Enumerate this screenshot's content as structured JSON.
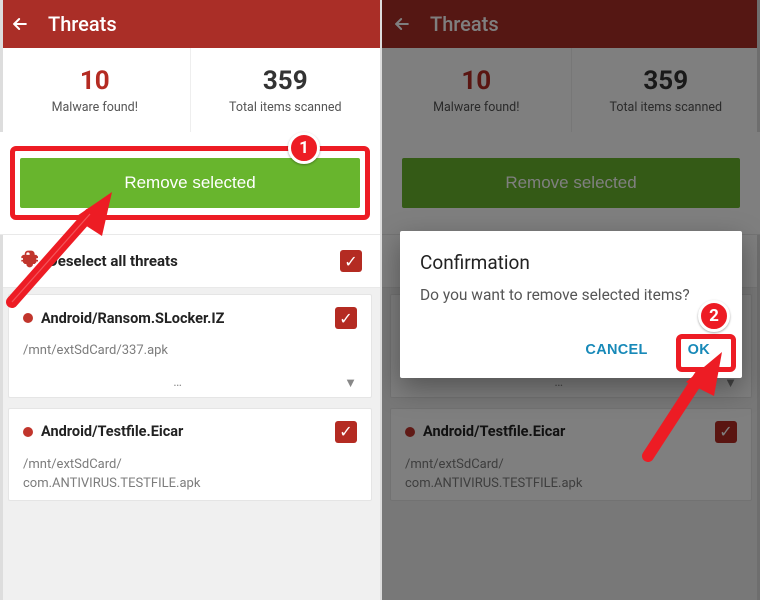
{
  "appbar": {
    "title": "Threats"
  },
  "stats": {
    "malware_count": "10",
    "malware_label": "Malware found!",
    "scanned_count": "359",
    "scanned_label": "Total items scanned"
  },
  "buttons": {
    "remove_selected": "Remove selected",
    "deselect_all": "Deselect all threats"
  },
  "threats": [
    {
      "name": "Android/Ransom.SLocker.IZ",
      "path": "/mnt/extSdCard/337.apk",
      "checked": true
    },
    {
      "name": "Android/Testfile.Eicar",
      "path": "/mnt/extSdCard/\ncom.ANTIVIRUS.TESTFILE.apk",
      "checked": true
    }
  ],
  "dialog": {
    "title": "Confirmation",
    "message": "Do you want to remove selected items?",
    "cancel": "CANCEL",
    "ok": "OK"
  },
  "callouts": {
    "one": "1",
    "two": "2"
  },
  "ellipsis": "…"
}
